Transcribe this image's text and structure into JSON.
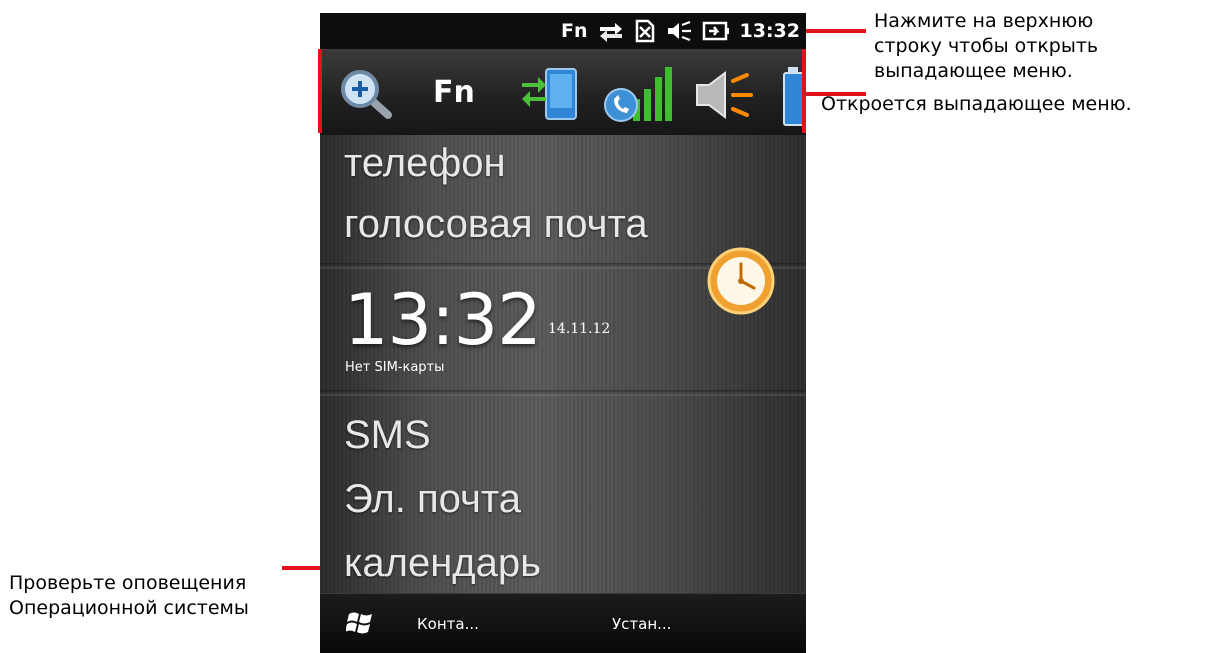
{
  "status_bar": {
    "fn_label": "Fn",
    "time": "13:32",
    "icons": [
      "data-transfer-icon",
      "sim-card-icon",
      "speaker-muted-icon",
      "battery-charging-icon"
    ]
  },
  "quick_toolbar": {
    "fn_label": "Fn",
    "icons": [
      "zoom-in-icon",
      "sync-icon",
      "signal-strength-icon",
      "volume-icon",
      "battery-icon"
    ]
  },
  "home_menu": {
    "items": [
      "телефон",
      "голосовая почта",
      "SMS",
      "Эл. почта",
      "календарь"
    ]
  },
  "clock_tile": {
    "time": "13:32",
    "date": "14.11.12",
    "sim_status": "Нет SIM-карты",
    "icon": "clock-icon"
  },
  "soft_keys": {
    "start_icon": "windows-logo-icon",
    "left_label": "Конта...",
    "right_label": "Устан..."
  },
  "annotations": {
    "top_right": "Нажмите на верхнюю\nстроку чтобы открыть\nвыпадающее меню.",
    "middle_right": "Откроется выпадающее меню.",
    "bottom_left": "Проверьте оповещения\nОперационной системы"
  },
  "colors": {
    "annotation_red": "#e3111a",
    "clock_orange": "#f0a030",
    "signal_green": "#3fbf2f"
  }
}
